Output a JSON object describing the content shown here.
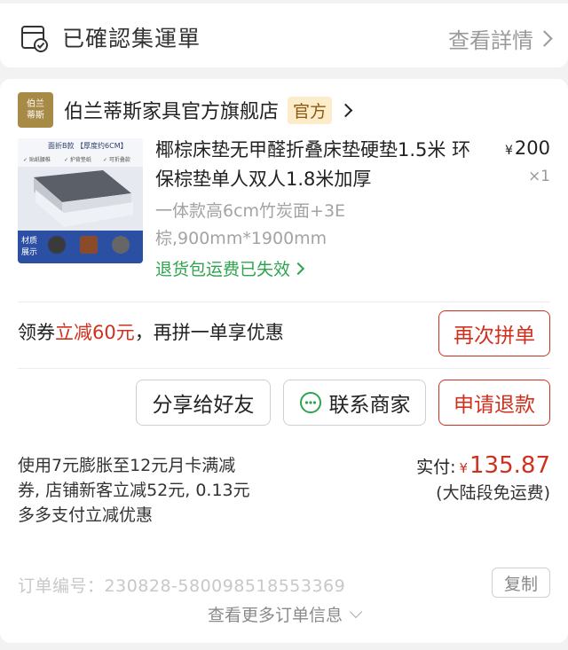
{
  "status": {
    "text": "已確認集運單",
    "link_label": "查看詳情"
  },
  "store": {
    "logo_line1": "伯兰",
    "logo_line2": "蒂斯",
    "name": "伯兰蒂斯家具官方旗舰店",
    "badge": "官方"
  },
  "product": {
    "image_banner": "面折B款 【厚度约6CM】",
    "image_features": [
      "✓ 贴纸腰椎",
      "✓ 护背垫纸",
      "✓ 可折叠款"
    ],
    "image_material_label_1": "材质",
    "image_material_label_2": "展示",
    "title": "椰棕床垫无甲醛折叠床垫硬垫1.5米 环保棕垫单人双人1.8米加厚",
    "price_symbol": "¥",
    "price": "200",
    "quantity": "×1",
    "spec": "一体款高6cm竹炭面+3E棕,900mm*1900mm",
    "return_note": "退货包运费已失效"
  },
  "promo": {
    "prefix": "领券",
    "highlight": "立减60元",
    "suffix": "，再拼一单享优惠",
    "reorder_label": "再次拼单"
  },
  "actions": {
    "share_label": "分享给好友",
    "contact_label": "联系商家",
    "refund_label": "申请退款"
  },
  "payment": {
    "coupon_note": "使用7元膨胀至12元月卡满减券, 店铺新客立减52元, 0.13元多多支付立减优惠",
    "paid_label": "实付:",
    "currency": "¥",
    "amount": "135.87",
    "shipping_note": "(大陆段免运费)"
  },
  "order": {
    "number_label": "订单编号：",
    "number": "230828-580098518553369",
    "copy_label": "复制",
    "more_label": "查看更多订单信息"
  },
  "colors": {
    "accent_red": "#d0311f",
    "green": "#2ea44f",
    "badge_bg": "#fcecc9",
    "store_logo": "#a88a47"
  }
}
